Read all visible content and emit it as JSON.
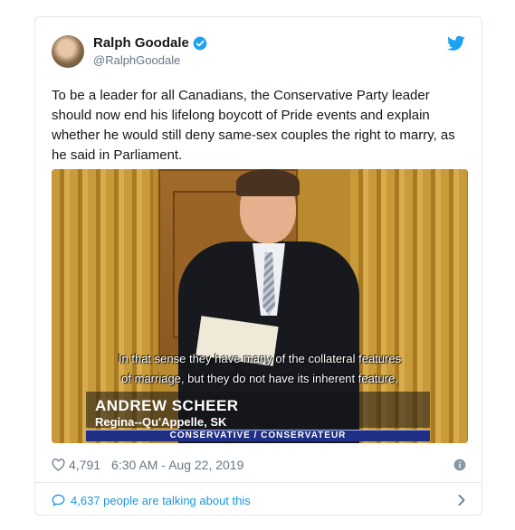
{
  "user": {
    "display_name": "Ralph Goodale",
    "handle": "@RalphGoodale"
  },
  "tweet": {
    "text": "To be a leader for all Canadians, the Conservative Party leader should now end his lifelong boycott of Pride events and explain whether he would still deny same-sex couples the right to marry, as he said in Parliament."
  },
  "video": {
    "subtitle_line1": "In that sense they have many of the collateral features",
    "subtitle_line2": "of marriage, but they do not have its inherent feature,",
    "speaker_name": "ANDREW SCHEER",
    "speaker_riding": "Regina--Qu'Appelle, SK",
    "party_label": "CONSERVATIVE / CONSERVATEUR"
  },
  "meta": {
    "likes": "4,791",
    "timestamp": "6:30 AM - Aug 22, 2019"
  },
  "footer": {
    "talking_label": "4,637 people are talking about this"
  },
  "icons": {
    "avatar": "avatar",
    "verified": "verified-badge-icon",
    "twitter": "twitter-bird-icon",
    "like": "heart-icon",
    "info": "info-icon",
    "reply": "speech-bubble-icon",
    "chevron": "chevron-right-icon"
  },
  "colors": {
    "twitter_blue": "#1da1f2",
    "link_blue": "#1b95e0",
    "secondary_text": "#657786",
    "border": "#e1e8ed"
  }
}
